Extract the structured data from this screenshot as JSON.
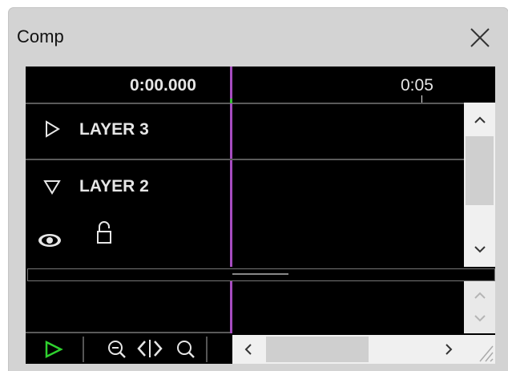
{
  "window": {
    "title": "Comp"
  },
  "timeline": {
    "current_time": "0:00.000",
    "ruler_label": "0:05"
  },
  "layers": [
    {
      "label": "LAYER 3",
      "expanded": false
    },
    {
      "label": "LAYER 2",
      "expanded": true
    }
  ],
  "icons": {
    "close": "close-icon",
    "collapsed": "triangle-right-icon",
    "expanded": "triangle-down-icon",
    "visibility": "eye-icon",
    "lock": "unlock-icon",
    "play": "play-icon",
    "zoom_out": "zoom-out-icon",
    "fit": "fit-width-icon",
    "zoom_in": "zoom-icon"
  },
  "colors": {
    "playhead": "#a64cc0",
    "play": "#2fd12f",
    "panel_bg": "#d3d3d3",
    "timeline_bg": "#000000"
  }
}
